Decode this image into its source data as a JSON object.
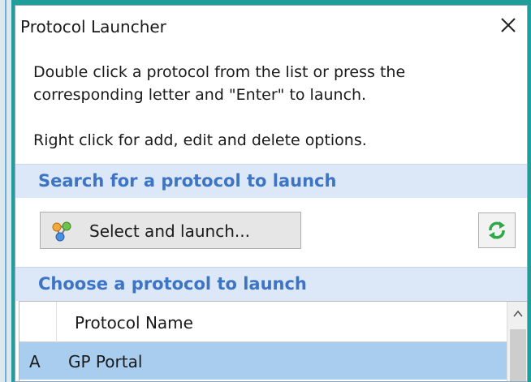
{
  "window": {
    "title": "Protocol Launcher"
  },
  "instructions": {
    "line1": "Double click a protocol from the list or press the",
    "line2": "corresponding letter and \"Enter\" to launch.",
    "line3": "Right click for add, edit and delete options."
  },
  "search_section": {
    "header": "Search for a protocol to launch",
    "select_button_label": "Select and launch...",
    "select_button_icon": "molecule-icon",
    "refresh_icon": "refresh-icon"
  },
  "choose_section": {
    "header": "Choose a protocol to launch",
    "columns": [
      "",
      "Protocol Name"
    ],
    "rows": [
      {
        "letter": "A",
        "name": "GP Portal",
        "selected": true
      }
    ]
  },
  "colors": {
    "section_header_bg": "#dce8f7",
    "section_header_text": "#3d74c4",
    "selected_row": "#a9cdef",
    "window_border": "#8fa8c0"
  }
}
